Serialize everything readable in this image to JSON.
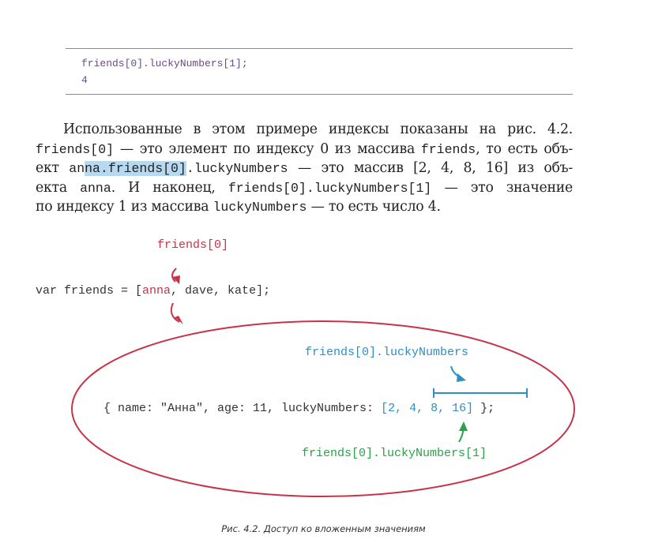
{
  "code_block": {
    "line1": "friends[0].luckyNumbers[1];",
    "line2": "4"
  },
  "paragraph": {
    "l1": "Использованные в этом примере индексы показаны на рис. 4.2.",
    "l2_code1": "friends[0]",
    "l2_text1": " — это элемент по индексу 0 из массива ",
    "l2_code2": "friends",
    "l2_text2": ", то есть объ-",
    "l3_text1": "ект ",
    "l3_code1a": "an",
    "l3_code1b": "na.friends[0]",
    "l3_code1c": ".luckyNumbers",
    "l3_text2": " — это массив [2, 4, 8, 16] из объ-",
    "l4_text1": "екта ",
    "l4_code1": "anna",
    "l4_text2": ". И наконец, ",
    "l4_code2": "friends[0].luckyNumbers[1]",
    "l4_text3": " — это значение",
    "l5_text1": "по индексу 1 из массива ",
    "l5_code1": "luckyNumbers",
    "l5_text2": " — то есть число 4."
  },
  "figure": {
    "label_friends0": "friends[0]",
    "var_prefix": "var friends = [",
    "var_anna": "anna",
    "var_rest": ", dave, kate];",
    "label_lucky": "friends[0].luckyNumbers",
    "obj_prefix": "{ name: \"Анна\", age: 11, luckyNumbers: ",
    "obj_array": "[2, 4, 8, 16]",
    "obj_suffix": " };",
    "label_lucky1": "friends[0].luckyNumbers[1]",
    "colors": {
      "red": "#c8334a",
      "blue": "#2f8fc4",
      "green": "#2aa24c"
    }
  },
  "caption": "Рис. 4.2. Доступ ко вложенным значениям"
}
